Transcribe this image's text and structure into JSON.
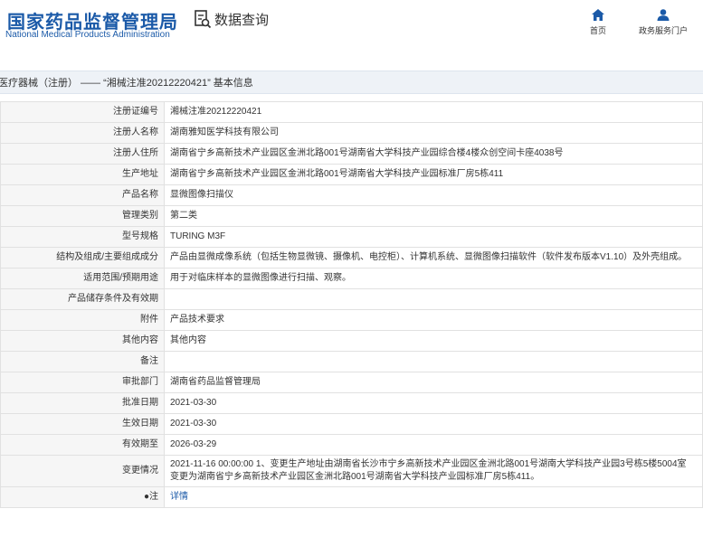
{
  "header": {
    "logo_cn": "国家药品监督管理局",
    "logo_en": "National Medical Products Administration",
    "search_label": "数据查询",
    "nav": [
      {
        "label": "首页",
        "icon": "home-icon"
      },
      {
        "label": "政务服务门户",
        "icon": "user-icon"
      }
    ],
    "accent": "#1b5aa8"
  },
  "breadcrumb": "医疗器械（注册） —— “湘械注准20212220421” 基本信息",
  "rows": [
    {
      "label": "注册证编号",
      "value": "湘械注准20212220421"
    },
    {
      "label": "注册人名称",
      "value": "湖南雅知医学科技有限公司"
    },
    {
      "label": "注册人住所",
      "value": "湖南省宁乡高新技术产业园区金洲北路001号湖南省大学科技产业园综合楼4楼众创空间卡座4038号"
    },
    {
      "label": "生产地址",
      "value": "湖南省宁乡高新技术产业园区金洲北路001号湖南省大学科技产业园标准厂房5栋411"
    },
    {
      "label": "产品名称",
      "value": "显微图像扫描仪"
    },
    {
      "label": "管理类别",
      "value": "第二类"
    },
    {
      "label": "型号规格",
      "value": "TURING M3F"
    },
    {
      "label": "结构及组成/主要组成成分",
      "value": "产品由显微成像系统（包括生物显微镜、摄像机、电控柜）、计算机系统、显微图像扫描软件（软件发布版本V1.10）及外壳组成。"
    },
    {
      "label": "适用范围/预期用途",
      "value": "用于对临床样本的显微图像进行扫描、观察。"
    },
    {
      "label": "产品储存条件及有效期",
      "value": ""
    },
    {
      "label": "附件",
      "value": "产品技术要求"
    },
    {
      "label": "其他内容",
      "value": "其他内容"
    },
    {
      "label": "备注",
      "value": ""
    },
    {
      "label": "审批部门",
      "value": "湖南省药品监督管理局"
    },
    {
      "label": "批准日期",
      "value": "2021-03-30"
    },
    {
      "label": "生效日期",
      "value": "2021-03-30"
    },
    {
      "label": "有效期至",
      "value": "2026-03-29"
    }
  ],
  "change": {
    "label": "变更情况",
    "line1": "2021-11-16 00:00:00 1、变更生产地址由湖南省长沙市宁乡高新技术产业园区金洲北路001号湖南大学科技产业园3号栋5楼5004室",
    "line2": "变更为湖南省宁乡高新技术产业园区金洲北路001号湖南省大学科技产业园标准厂房5栋411。"
  },
  "note": {
    "label": "●注",
    "link": "详情"
  }
}
